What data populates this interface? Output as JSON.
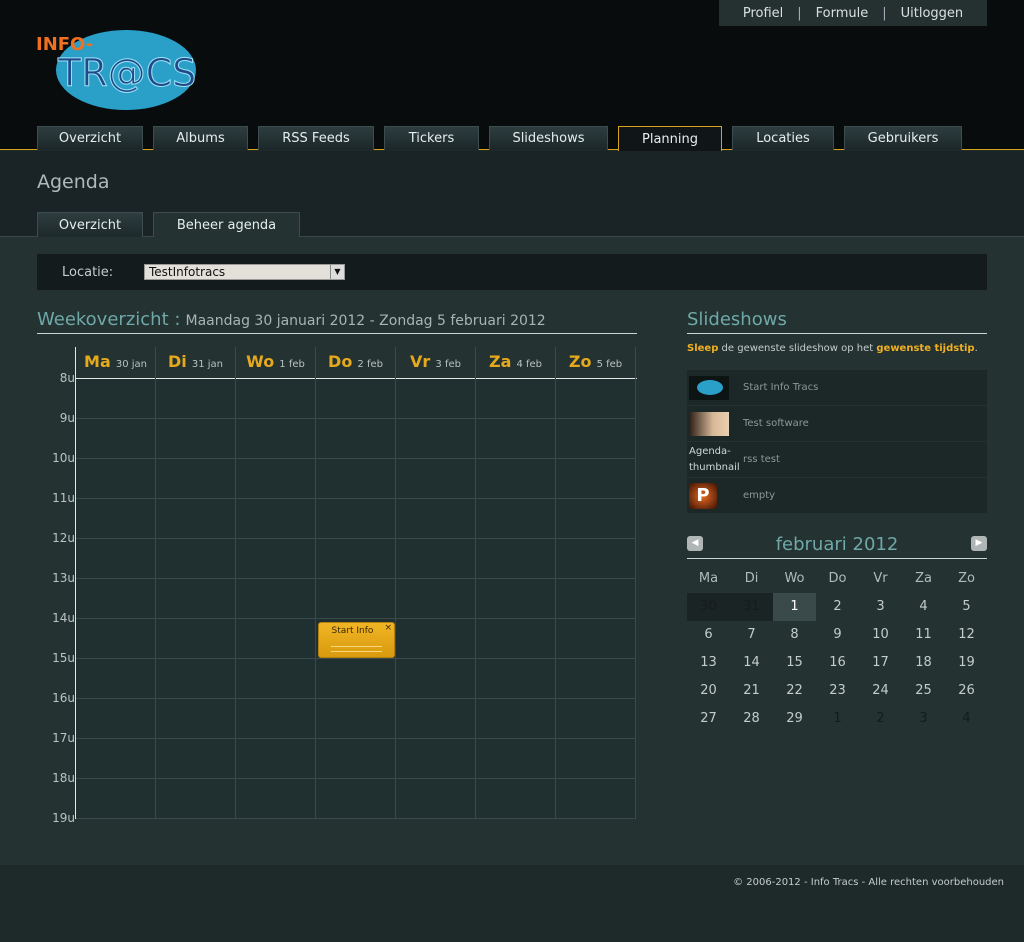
{
  "top_links": [
    "Profiel",
    "Formule",
    "Uitloggen"
  ],
  "logo": {
    "text_top": "INFO-",
    "text_main": "TR@CS"
  },
  "main_nav": [
    {
      "label": "Overzicht",
      "w": 106
    },
    {
      "label": "Albums",
      "w": 95
    },
    {
      "label": "RSS Feeds",
      "w": 116
    },
    {
      "label": "Tickers",
      "w": 95
    },
    {
      "label": "Slideshows",
      "w": 119
    },
    {
      "label": "Planning",
      "w": 104,
      "active": true
    },
    {
      "label": "Locaties",
      "w": 102
    },
    {
      "label": "Gebruikers",
      "w": 118
    }
  ],
  "page_title": "Agenda",
  "sub_nav": [
    {
      "label": "Overzicht"
    },
    {
      "label": "Beheer agenda",
      "active": true
    }
  ],
  "location": {
    "label": "Locatie:",
    "value": "TestInfotracs"
  },
  "week": {
    "title": "Weekoverzicht :",
    "range": "Maandag 30 januari 2012 - Zondag 5 februari 2012",
    "days": [
      {
        "d": "Ma",
        "s": "30 jan"
      },
      {
        "d": "Di",
        "s": "31 jan"
      },
      {
        "d": "Wo",
        "s": "1 feb"
      },
      {
        "d": "Do",
        "s": "2 feb"
      },
      {
        "d": "Vr",
        "s": "3 feb"
      },
      {
        "d": "Za",
        "s": "4 feb"
      },
      {
        "d": "Zo",
        "s": "5 feb"
      }
    ],
    "hours": [
      "8u",
      "9u",
      "10u",
      "11u",
      "12u",
      "13u",
      "14u",
      "15u",
      "16u",
      "17u",
      "18u",
      "19u"
    ],
    "event": {
      "title": "Start Info",
      "day": "Do",
      "start": "14u",
      "end": "15u",
      "close": "×"
    }
  },
  "slideshows": {
    "title": "Slideshows",
    "hint_1": "Sleep",
    "hint_2": " de gewenste slideshow op het ",
    "hint_3": "gewenste tijdstip",
    "hint_4": ".",
    "items": [
      {
        "name": "Start Info Tracs",
        "thumb": "tracs-logo"
      },
      {
        "name": "Test software",
        "thumb": "photo"
      },
      {
        "name": "rss test",
        "thumb_alt": "Agenda-thumbnail"
      },
      {
        "name": "empty",
        "thumb": "p-logo"
      }
    ]
  },
  "calendar": {
    "month": "februari 2012",
    "prev": "◀",
    "next": "▶",
    "weekdays": [
      "Ma",
      "Di",
      "Wo",
      "Do",
      "Vr",
      "Za",
      "Zo"
    ],
    "days": [
      [
        "30",
        "prev"
      ],
      [
        "31",
        "prev"
      ],
      [
        "1",
        "today"
      ],
      [
        "2",
        ""
      ],
      [
        "3",
        ""
      ],
      [
        "4",
        ""
      ],
      [
        "5",
        ""
      ],
      [
        "6",
        ""
      ],
      [
        "7",
        ""
      ],
      [
        "8",
        ""
      ],
      [
        "9",
        ""
      ],
      [
        "10",
        ""
      ],
      [
        "11",
        ""
      ],
      [
        "12",
        ""
      ],
      [
        "13",
        ""
      ],
      [
        "14",
        ""
      ],
      [
        "15",
        ""
      ],
      [
        "16",
        ""
      ],
      [
        "17",
        ""
      ],
      [
        "18",
        ""
      ],
      [
        "19",
        ""
      ],
      [
        "20",
        ""
      ],
      [
        "21",
        ""
      ],
      [
        "22",
        ""
      ],
      [
        "23",
        ""
      ],
      [
        "24",
        ""
      ],
      [
        "25",
        ""
      ],
      [
        "26",
        ""
      ],
      [
        "27",
        ""
      ],
      [
        "28",
        ""
      ],
      [
        "29",
        ""
      ],
      [
        "1",
        "other"
      ],
      [
        "2",
        "other"
      ],
      [
        "3",
        "other"
      ],
      [
        "4",
        "other"
      ]
    ]
  },
  "footer": "© 2006-2012 - Info Tracs - Alle rechten voorbehouden",
  "colors": {
    "accent": "#e6a91e",
    "heading": "#6fa8a8",
    "event": "#f0b525"
  }
}
